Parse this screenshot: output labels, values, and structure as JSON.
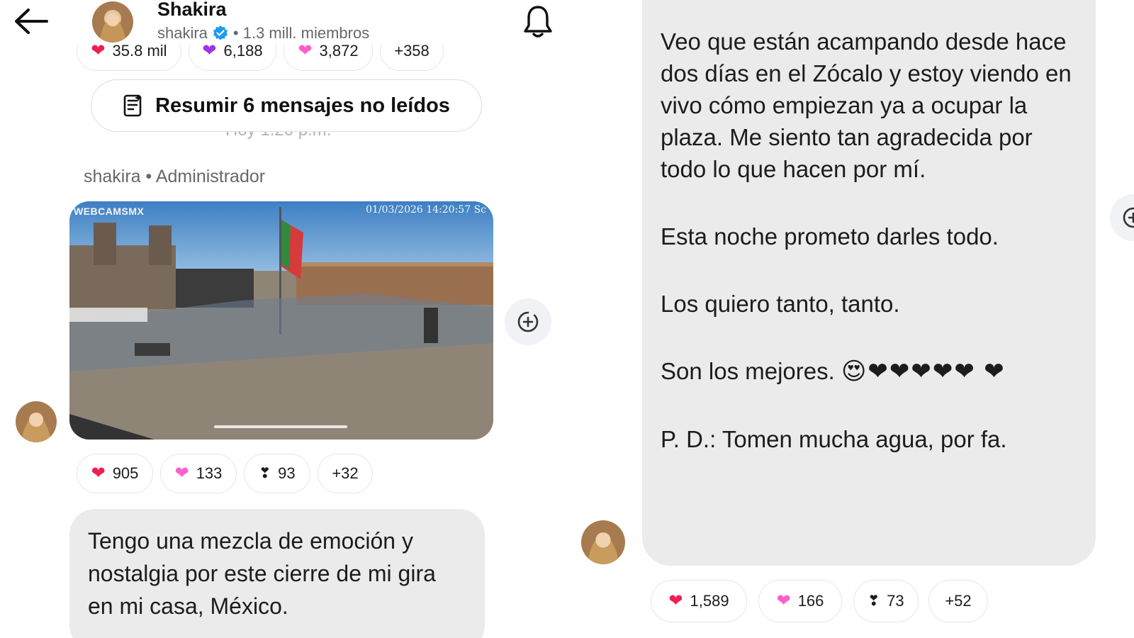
{
  "header": {
    "title": "Shakira",
    "handle": "shakira",
    "members": "• 1.3 mill. miembros"
  },
  "top_reactions": [
    {
      "emoji": "heart-red",
      "count": "35.8 mil"
    },
    {
      "emoji": "heart-purple",
      "count": "6,188"
    },
    {
      "emoji": "heart-pink",
      "count": "3,872"
    },
    {
      "emoji": "",
      "count": "+358"
    }
  ],
  "summary_button": {
    "label": "Resumir 6 mensajes no leídos"
  },
  "faded_timestamp": "Hoy 1:20 p.m.",
  "post": {
    "sender": "shakira • Administrador",
    "image": {
      "caption": "WEBCAMSMX",
      "stamp": "01/03/2026 14:20:57 Sc"
    },
    "reactions": [
      {
        "emoji": "heart-red",
        "count": "905"
      },
      {
        "emoji": "heart-pink",
        "count": "133"
      },
      {
        "emoji": "exclamation-heart",
        "count": "93"
      },
      {
        "emoji": "",
        "count": "+32"
      }
    ]
  },
  "message_left": {
    "text": "Tengo una mezcla de emoción y nostalgia por este cierre de mi gira en mi casa, México."
  },
  "message_right": {
    "p1": "Veo que están acampando desde hace dos días en el Zócalo y estoy viendo en vivo cómo empiezan ya a ocupar la plaza. Me siento tan agradecida por todo lo que hacen por mí.",
    "p2": "Esta noche prometo darles todo.",
    "p3": "Los quiero tanto, tanto.",
    "p4": "Son los mejores.",
    "p4_emoji": "😍❤❤❤❤❤ ❤",
    "p5": "P. D.: Tomen mucha agua, por fa.",
    "reactions": [
      {
        "emoji": "heart-red",
        "count": "1,589"
      },
      {
        "emoji": "heart-pink",
        "count": "166"
      },
      {
        "emoji": "exclamation-heart",
        "count": "73"
      },
      {
        "emoji": "",
        "count": "+52"
      }
    ]
  },
  "icons": {
    "back": "back-arrow-icon",
    "bell": "bell-icon",
    "summary": "summary-doc-icon",
    "share": "add-reaction-icon",
    "verified": "verified-badge-icon"
  },
  "colors": {
    "bubble": "#ebebeb",
    "verified": "#1d9bf0",
    "heart_red": "#ee1d52",
    "heart_pink": "#ff5fc9",
    "heart_purple": "#a033e8"
  }
}
